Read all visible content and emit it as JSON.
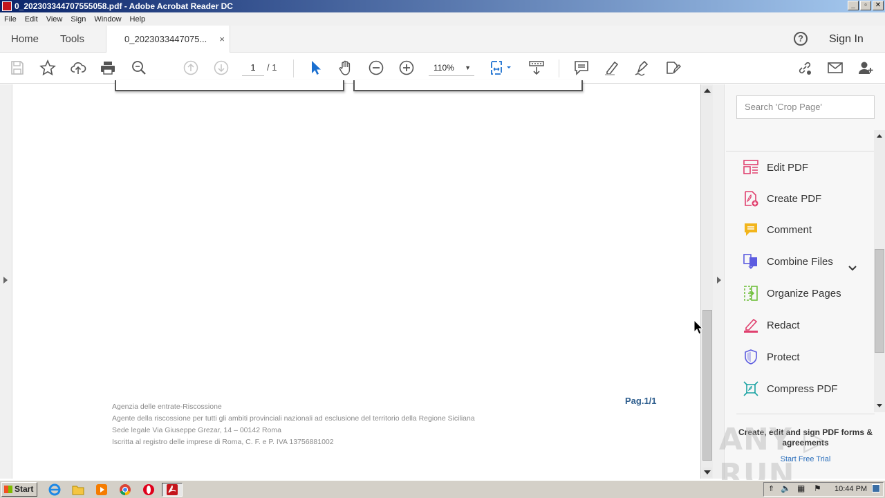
{
  "window": {
    "title": "0_20230334470755 5058.pdf - Adobe Acrobat Reader DC",
    "title_exact": "0_202303344707555058.pdf - Adobe Acrobat Reader DC",
    "controls": [
      "_",
      "▫",
      "✕"
    ]
  },
  "menu": [
    "File",
    "Edit",
    "View",
    "Sign",
    "Window",
    "Help"
  ],
  "tabs": {
    "home": "Home",
    "tools": "Tools",
    "document": "0_2023033447075...",
    "close": "×"
  },
  "header": {
    "help_glyph": "?",
    "sign_in": "Sign In"
  },
  "toolbar": {
    "page_current": "1",
    "page_total": "/ 1",
    "zoom": "110%"
  },
  "document": {
    "footer_lines": [
      "Agenzia delle entrate-Riscossione",
      "Agente della riscossione per tutti gli ambiti provinciali nazionali ad esclusione del territorio della Regione Siciliana",
      "Sede legale Via Giuseppe Grezar, 14   –  00142 Roma",
      "Iscritta al registro delle imprese di Roma, C. F. e P. IVA 13756881002"
    ],
    "page_label": "Pag.1/1"
  },
  "right_pane": {
    "search_placeholder": "Search 'Crop Page'",
    "tools": [
      {
        "label": "Edit PDF",
        "color": "#e0406e",
        "icon": "edit-pdf-icon"
      },
      {
        "label": "Create PDF",
        "color": "#e0406e",
        "icon": "create-pdf-icon"
      },
      {
        "label": "Comment",
        "color": "#f2b51c",
        "icon": "comment-icon"
      },
      {
        "label": "Combine Files",
        "color": "#5c5ce0",
        "icon": "combine-files-icon"
      },
      {
        "label": "Organize Pages",
        "color": "#6fbf3a",
        "icon": "organize-pages-icon"
      },
      {
        "label": "Redact",
        "color": "#e0406e",
        "icon": "redact-icon"
      },
      {
        "label": "Protect",
        "color": "#5c5ce0",
        "icon": "protect-icon"
      },
      {
        "label": "Compress PDF",
        "color": "#1aa3a3",
        "icon": "compress-pdf-icon"
      }
    ],
    "promo_title": "Create, edit and sign PDF forms & agreements",
    "promo_link": "Start Free Trial"
  },
  "taskbar": {
    "start": "Start",
    "clock": "10:44 PM"
  },
  "watermark": "ANY RUN"
}
